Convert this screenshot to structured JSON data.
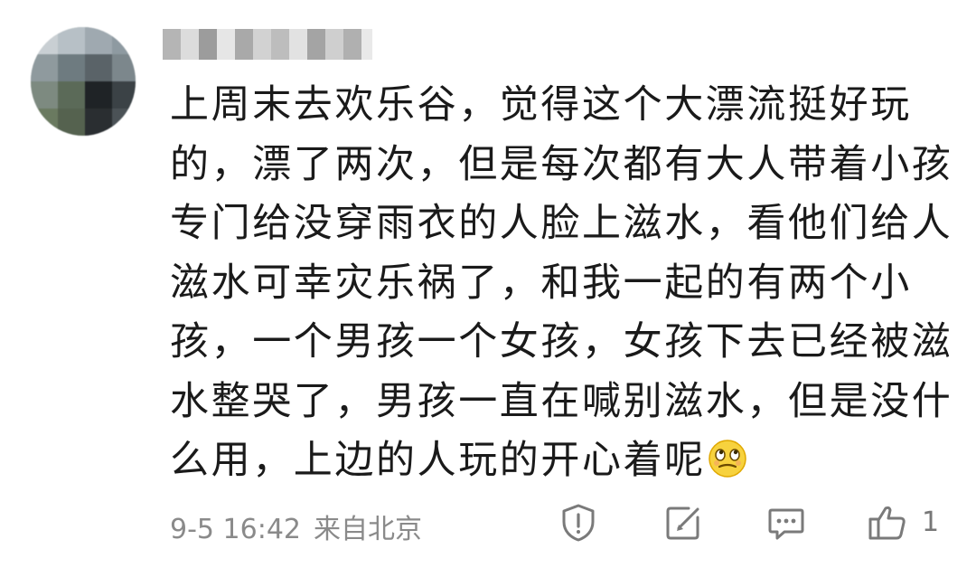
{
  "comment": {
    "lines": [
      "上周末去欢乐谷，觉得这个大漂流挺好玩",
      "的，漂了两次，但是每次都有大人带着小孩",
      "专门给没穿雨衣的人脸上滋水，看他们给人",
      "滋水可幸灾乐祸了，和我一起的有两个小",
      "孩，一个男孩一个女孩，女孩下去已经被滋",
      "水整哭了，男孩一直在喊别滋水，但是没什",
      "么用，上边的人玩的开心着呢"
    ],
    "trailing_emoji": "smirk-emoji"
  },
  "meta": {
    "date_time": "9-5 16:42",
    "location": "来自北京"
  },
  "actions": {
    "report_icon": "report-shield-icon",
    "edit_icon": "share-edit-icon",
    "reply_icon": "comment-bubble-icon",
    "like_icon": "thumbs-up-icon",
    "like_count": "1"
  },
  "colors": {
    "text": "#1a1a1a",
    "meta_text": "#8a8a8a",
    "icon": "#7a7a7a"
  }
}
